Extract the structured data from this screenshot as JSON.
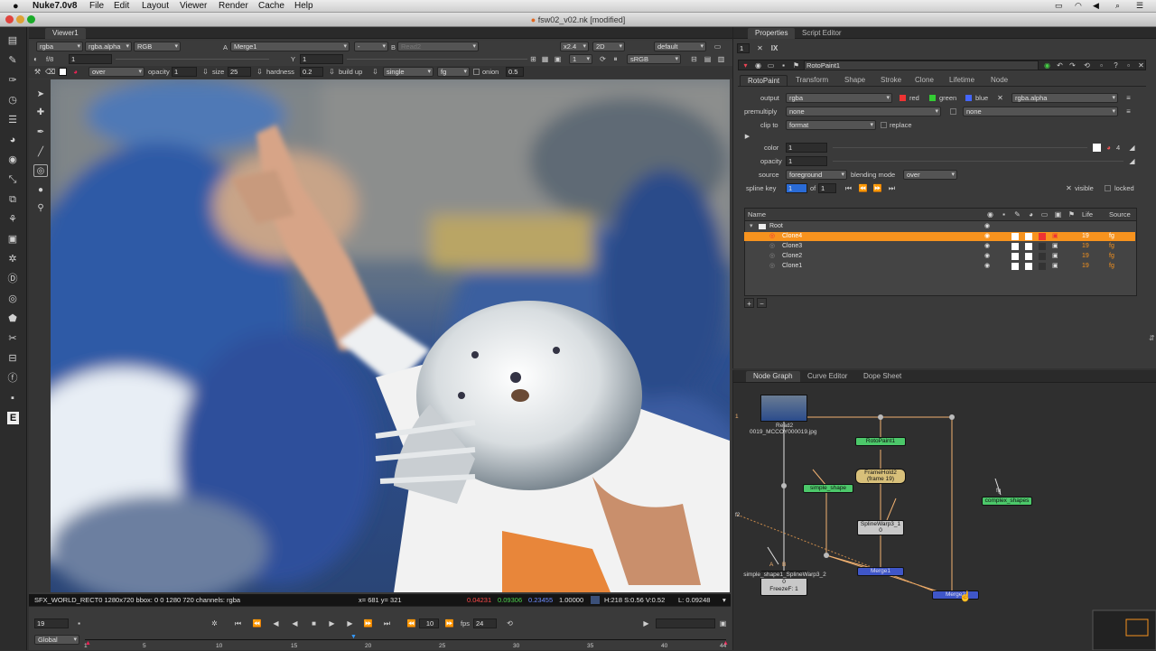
{
  "menubar": {
    "app": "Nuke7.0v8",
    "items": [
      "File",
      "Edit",
      "Layout",
      "Viewer",
      "Render",
      "Cache",
      "Help"
    ]
  },
  "window_title": "fsw02_v02.nk [modified]",
  "viewer": {
    "tab": "Viewer1",
    "row1": {
      "channels": "rgba",
      "alpha": "rgba.alpha",
      "mode": "RGB",
      "a_label": "A",
      "a_input": "Merge1",
      "dash": "-",
      "b_label": "B",
      "b_input": "Read2",
      "zoom": "x2.4",
      "view": "2D",
      "lut": "default"
    },
    "row2": {
      "fstop": "f/8",
      "gain": "1",
      "y_label": "Y",
      "y_value": "1",
      "proxy": "1",
      "colorspace": "sRGB"
    },
    "row3": {
      "mode": "over",
      "opacity_label": "opacity",
      "opacity": "1",
      "size_label": "size",
      "size": "25",
      "hardness_label": "hardness",
      "hardness": "0.2",
      "buildup_label": "build up",
      "brush": "single",
      "target": "fg",
      "onion_label": "onion",
      "onion": "0.5"
    },
    "info": {
      "format": "SFX_WORLD_RECT0 1280x720 bbox: 0 0 1280 720 channels: rgba",
      "coords": "x= 681 y= 321",
      "r": "0.04231",
      "g": "0.09306",
      "b": "0.23455",
      "a": "1.00000",
      "hsv": "H:218 S:0.56 V:0.52",
      "lum": "L: 0.09248"
    },
    "timeline": {
      "frame": "19",
      "scope": "Global",
      "increment": "10",
      "fps_label": "fps",
      "fps": "24",
      "ticks": [
        "1",
        "5",
        "10",
        "15",
        "20",
        "25",
        "30",
        "35",
        "40",
        "44"
      ]
    }
  },
  "properties": {
    "tabs": [
      "Properties",
      "Script Editor"
    ],
    "node_count": "1",
    "node_name": "RotoPaint1",
    "node_tabs": [
      "RotoPaint",
      "Transform",
      "Shape",
      "Stroke",
      "Clone",
      "Lifetime",
      "Node"
    ],
    "output_label": "output",
    "output": "rgba",
    "ch_red": "red",
    "ch_green": "green",
    "ch_blue": "blue",
    "ch_alpha": "rgba.alpha",
    "premult_label": "premultiply",
    "premult": "none",
    "premult2": "none",
    "clip_label": "clip to",
    "clip": "format",
    "replace_label": "replace",
    "color_label": "color",
    "color": "1",
    "color_count": "4",
    "opacity_label": "opacity",
    "opacity": "1",
    "source_label": "source",
    "source": "foreground",
    "blend_label": "blending mode",
    "blend": "over",
    "spline_label": "spline key",
    "spline": "1",
    "of_label": "of",
    "spline_total": "1",
    "visible_label": "visible",
    "locked_label": "locked",
    "layers": {
      "headers": {
        "name": "Name",
        "life": "Life",
        "source": "Source"
      },
      "root": "Root",
      "rows": [
        {
          "name": "Clone4",
          "life": "19",
          "source": "fg",
          "selected": true
        },
        {
          "name": "Clone3",
          "life": "19",
          "source": "fg",
          "selected": false
        },
        {
          "name": "Clone2",
          "life": "19",
          "source": "fg",
          "selected": false
        },
        {
          "name": "Clone1",
          "life": "19",
          "source": "fg",
          "selected": false
        }
      ]
    }
  },
  "nodegraph": {
    "tabs": [
      "Node Graph",
      "Curve Editor",
      "Dope Sheet"
    ],
    "nodes": {
      "read2": "Read2",
      "read2_file": "0019_MCCOY000019.jpg",
      "rotopaint": "RotoPaint1",
      "framehold": "FrameHold2",
      "framehold_sub": "(frame 19)",
      "simple_shape": "simple_shape",
      "complex_shapes": "complex_shapes",
      "splinewarp3": "SplineWarp3_1",
      "splinewarp3_sub": "0",
      "splinewarp2": "simple_shape1_SplineWarp3_2",
      "splinewarp2_sub": "0",
      "freeze": "FreezeF: 1",
      "merge_a": "Merge1",
      "merge_b": "Merge2",
      "label_fg": "fg",
      "label_f2": "f2",
      "label_a": "A",
      "label_b": "B",
      "label_1": "1"
    }
  },
  "colors": {
    "accent": "#f7931e",
    "selected_row": "#f7931e",
    "rotopaint_node": "#4cc86a",
    "framehold_node": "#d8c07a",
    "merge_node": "#3f56c8",
    "splinewarp_node": "#c8c8c8"
  }
}
